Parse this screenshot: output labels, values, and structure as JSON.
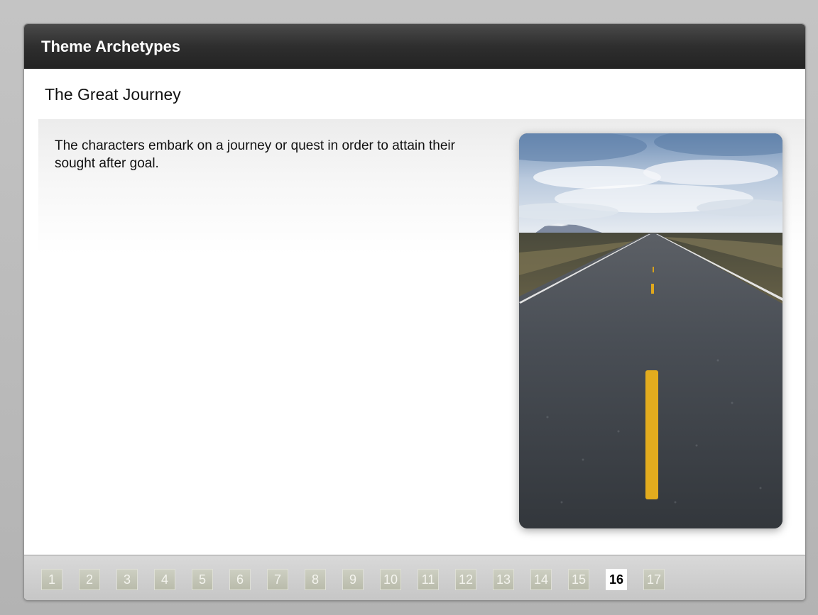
{
  "header": {
    "title": "Theme Archetypes"
  },
  "slide": {
    "title": "The Great Journey",
    "body": "The characters embark on a journey or quest in order to attain their sought after goal."
  },
  "image": {
    "subject": "road-photo"
  },
  "pagination": {
    "pages": [
      "1",
      "2",
      "3",
      "4",
      "5",
      "6",
      "7",
      "8",
      "9",
      "10",
      "11",
      "12",
      "13",
      "14",
      "15",
      "16",
      "17"
    ],
    "current": "16"
  },
  "colors": {
    "header_bg": "#2e2e2e",
    "page_button": "#c4c6b7",
    "current_page": "#ffffff"
  }
}
